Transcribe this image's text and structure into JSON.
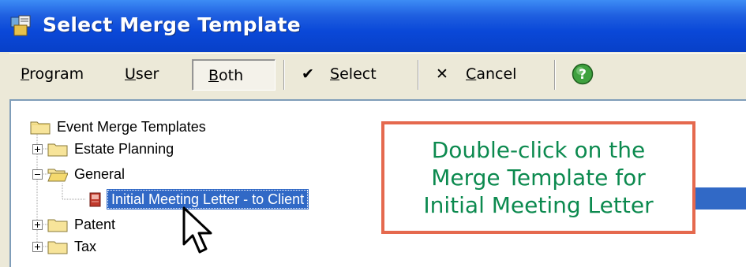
{
  "window": {
    "title": "Select Merge Template"
  },
  "toolbar": {
    "program": {
      "prefix": "",
      "key": "P",
      "rest": "rogram"
    },
    "user": {
      "prefix": "",
      "key": "U",
      "rest": "ser"
    },
    "both": {
      "prefix": "",
      "key": "B",
      "rest": "oth"
    },
    "select": {
      "prefix": "",
      "key": "S",
      "rest": "elect"
    },
    "cancel": {
      "prefix": "",
      "key": "C",
      "rest": "ancel"
    },
    "help_icon": "question-mark-icon"
  },
  "tree": {
    "root": "Event Merge Templates",
    "items": [
      {
        "label": "Estate Planning",
        "state": "collapsed"
      },
      {
        "label": "General",
        "state": "expanded"
      },
      {
        "label": "Initial Meeting Letter - to Client",
        "state": "selected"
      },
      {
        "label": "Patent",
        "state": "collapsed"
      },
      {
        "label": "Tax",
        "state": "collapsed"
      }
    ]
  },
  "callout": {
    "line1": "Double-click on the",
    "line2": "Merge Template for",
    "line3": "Initial Meeting Letter"
  },
  "colors": {
    "title_bar": "#0a48d8",
    "selection": "#3169c6",
    "callout_border": "#e5694e",
    "callout_text": "#0c8a4f"
  }
}
